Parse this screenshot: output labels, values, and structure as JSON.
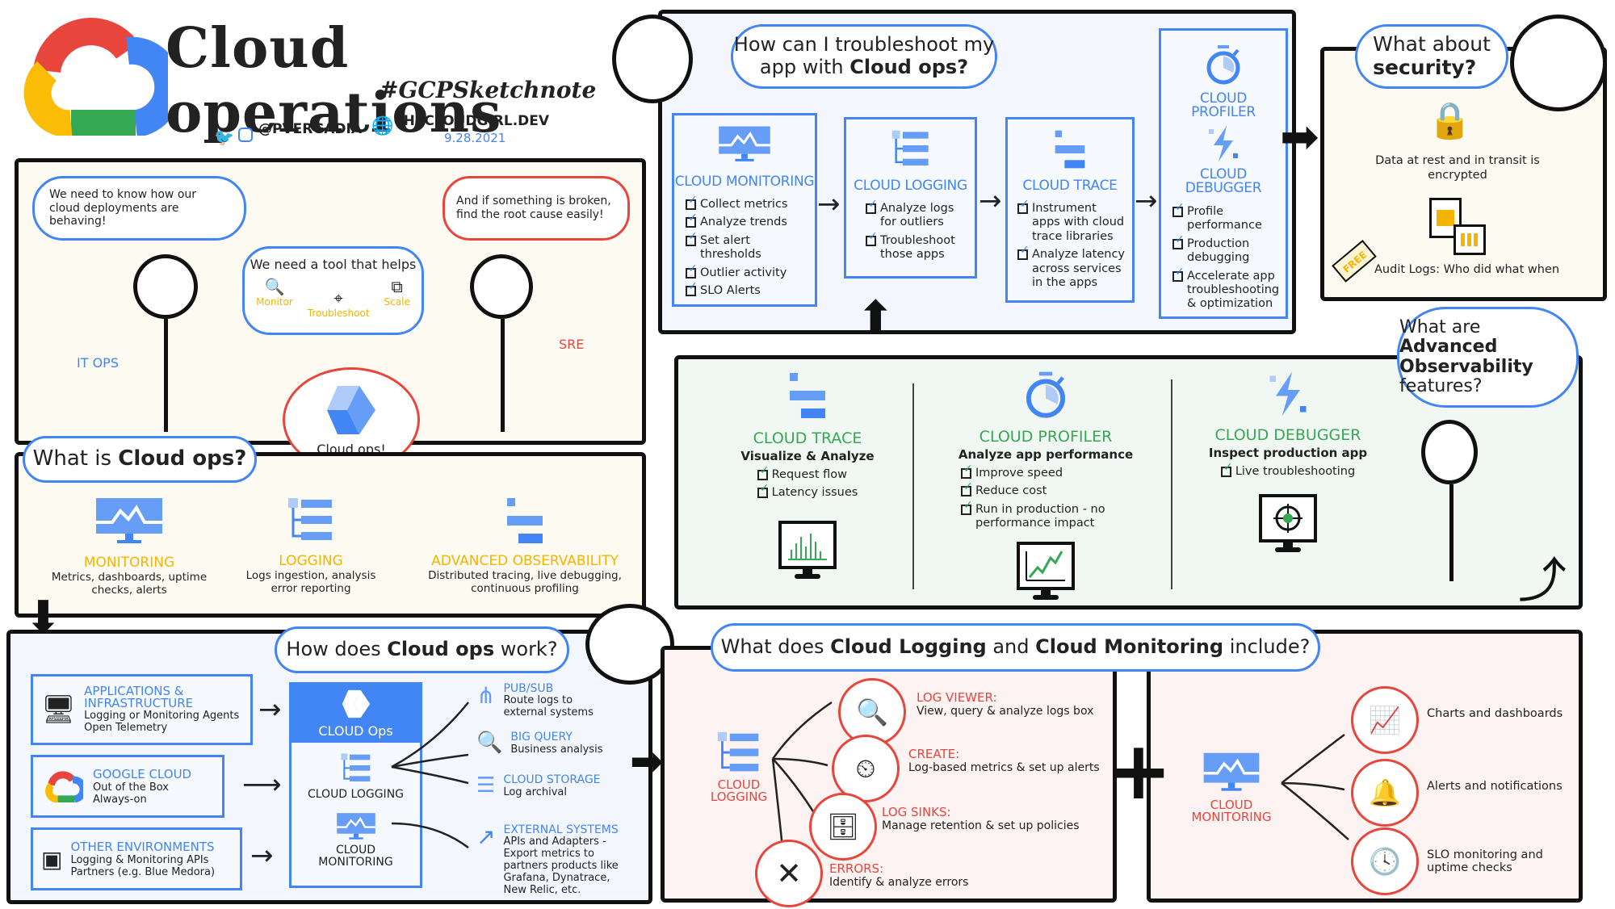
{
  "header": {
    "title": "Cloud operations",
    "hashtag": "#GCPSketchnote",
    "handle": "@PVERGADIA",
    "website": "THECLOUDGIRL.DEV",
    "date": "9.28.2021",
    "colors": {
      "blue": "#4285f4",
      "red": "#e8453c",
      "yellow": "#f4b400",
      "green": "#34a853"
    }
  },
  "intro": {
    "itops_bubble": "We need to know how our cloud deployments are behaving!",
    "tool_bubble_title": "We need a tool that helps",
    "tool_items": [
      {
        "icon": "monitor-magnifier-icon",
        "label": "Monitor"
      },
      {
        "icon": "troubleshoot-target-icon",
        "label": "Troubleshoot"
      },
      {
        "icon": "scale-icon",
        "label": "Scale"
      }
    ],
    "sre_bubble": "And if something is broken, find the root cause easily!",
    "itops_label": "IT OPS",
    "sre_label": "SRE",
    "cloudops_bubble": "Cloud ops!"
  },
  "what_is": {
    "question_plain": "What is ",
    "question_bold": "Cloud ops?",
    "items": [
      {
        "icon": "monitoring-icon",
        "title": "MONITORING",
        "desc": "Metrics, dashboards, uptime checks, alerts"
      },
      {
        "icon": "logging-icon",
        "title": "LOGGING",
        "desc": "Logs ingestion, analysis error reporting"
      },
      {
        "icon": "trace-icon",
        "title": "ADVANCED OBSERVABILITY",
        "desc": "Distributed tracing, live debugging, continuous profiling"
      }
    ]
  },
  "troubleshoot": {
    "question_plain": "How can I troubleshoot my app with ",
    "question_bold": "Cloud ops?",
    "steps": [
      {
        "title": "CLOUD MONITORING",
        "items": [
          "Collect metrics",
          "Analyze trends",
          "Set alert thresholds",
          "Outlier activity",
          "SLO Alerts"
        ]
      },
      {
        "title": "CLOUD LOGGING",
        "items": [
          "Analyze logs for outliers",
          "Troubleshoot those apps"
        ]
      },
      {
        "title": "CLOUD TRACE",
        "items": [
          "Instrument apps with cloud trace libraries",
          "Analyze latency across services in the apps"
        ]
      },
      {
        "title": "CLOUD PROFILER",
        "title2": "CLOUD DEBUGGER",
        "items": [
          "Profile performance",
          "Production debugging",
          "Accelerate app troubleshooting & optimization"
        ]
      }
    ]
  },
  "security": {
    "question_plain": "What about",
    "question_bold": "security?",
    "encryption": "Data at rest and in transit is encrypted",
    "free_tag": "FREE",
    "audit": "Audit Logs: Who did what when"
  },
  "advanced": {
    "question_plain": "What are",
    "question_bold": "Advanced Observability",
    "question_end": "features?",
    "features": [
      {
        "title": "CLOUD TRACE",
        "subtitle": "Visualize & Analyze",
        "items": [
          "Request flow",
          "Latency issues"
        ]
      },
      {
        "title": "CLOUD PROFILER",
        "subtitle": "Analyze app performance",
        "items": [
          "Improve speed",
          "Reduce cost",
          "Run in production - no performance impact"
        ]
      },
      {
        "title": "CLOUD DEBUGGER",
        "subtitle": "Inspect production app",
        "items": [
          "Live troubleshooting"
        ]
      }
    ]
  },
  "how_works": {
    "question_plain1": "How does ",
    "question_bold": "Cloud ops",
    "question_plain2": " work?",
    "sources": [
      {
        "title": "APPLICATIONS & INFRASTRUCTURE",
        "lines": [
          "Logging or Monitoring Agents",
          "Open Telemetry"
        ]
      },
      {
        "title": "GOOGLE CLOUD",
        "lines": [
          "Out of the Box",
          "Always-on"
        ]
      },
      {
        "title": "OTHER ENVIRONMENTS",
        "lines": [
          "Logging & Monitoring APIs",
          "Partners (e.g. Blue Medora)"
        ]
      }
    ],
    "center": {
      "header": "CLOUD Ops",
      "logging": "CLOUD LOGGING",
      "monitoring": "CLOUD MONITORING"
    },
    "destinations": [
      {
        "title": "PUB/SUB",
        "desc": "Route logs to external systems"
      },
      {
        "title": "BIG QUERY",
        "desc": "Business analysis"
      },
      {
        "title": "CLOUD STORAGE",
        "desc": "Log archival"
      },
      {
        "title": "EXTERNAL SYSTEMS",
        "desc": "APIs and Adapters - Export metrics to partners products like Grafana, Dynatrace, New Relic, etc."
      }
    ]
  },
  "includes": {
    "question_plain1": "What does ",
    "question_bold1": "Cloud Logging",
    "question_plain2": " and ",
    "question_bold2": "Cloud Monitoring",
    "question_plain3": " include?",
    "logging_label": "CLOUD LOGGING",
    "logging_items": [
      {
        "title": "LOG VIEWER:",
        "desc": "View, query & analyze logs box"
      },
      {
        "title": "CREATE:",
        "desc": "Log-based metrics & set up alerts"
      },
      {
        "title": "LOG SINKS:",
        "desc": "Manage retention & set up policies"
      },
      {
        "title": "ERRORS:",
        "desc": "Identify & analyze errors"
      }
    ],
    "monitoring_label": "CLOUD MONITORING",
    "monitoring_items": [
      {
        "desc": "Charts and dashboards"
      },
      {
        "desc": "Alerts and notifications"
      },
      {
        "desc": "SLO monitoring and uptime checks"
      }
    ]
  }
}
